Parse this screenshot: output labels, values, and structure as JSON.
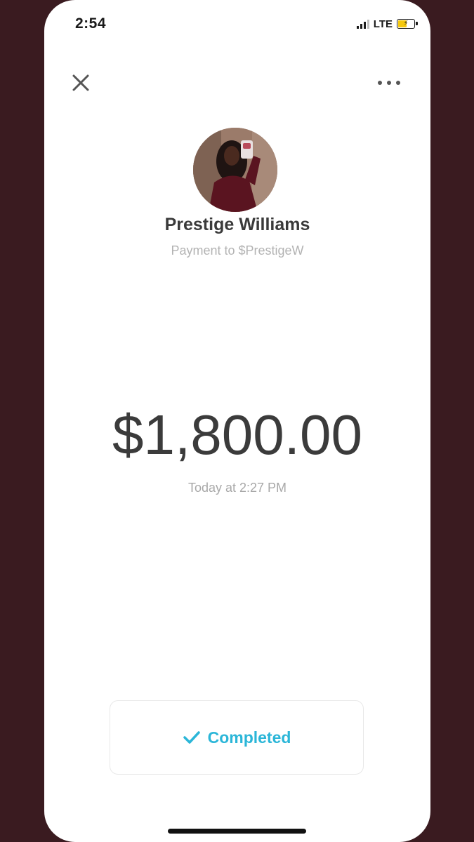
{
  "status_bar": {
    "time": "2:54",
    "network": "LTE",
    "icons": [
      "signal-icon",
      "battery-charging-icon"
    ]
  },
  "header": {
    "close_icon": "close-icon",
    "more_icon": "more-options-icon"
  },
  "recipient": {
    "name": "Prestige Williams",
    "subtitle": "Payment to $PrestigeW"
  },
  "payment": {
    "amount": "$1,800.00",
    "timestamp": "Today at 2:27 PM"
  },
  "status": {
    "label": "Completed",
    "icon": "checkmark-icon",
    "color": "#2bb6d8"
  },
  "colors": {
    "background": "#3a1b20",
    "surface": "#ffffff",
    "accent": "#2bb6d8"
  }
}
